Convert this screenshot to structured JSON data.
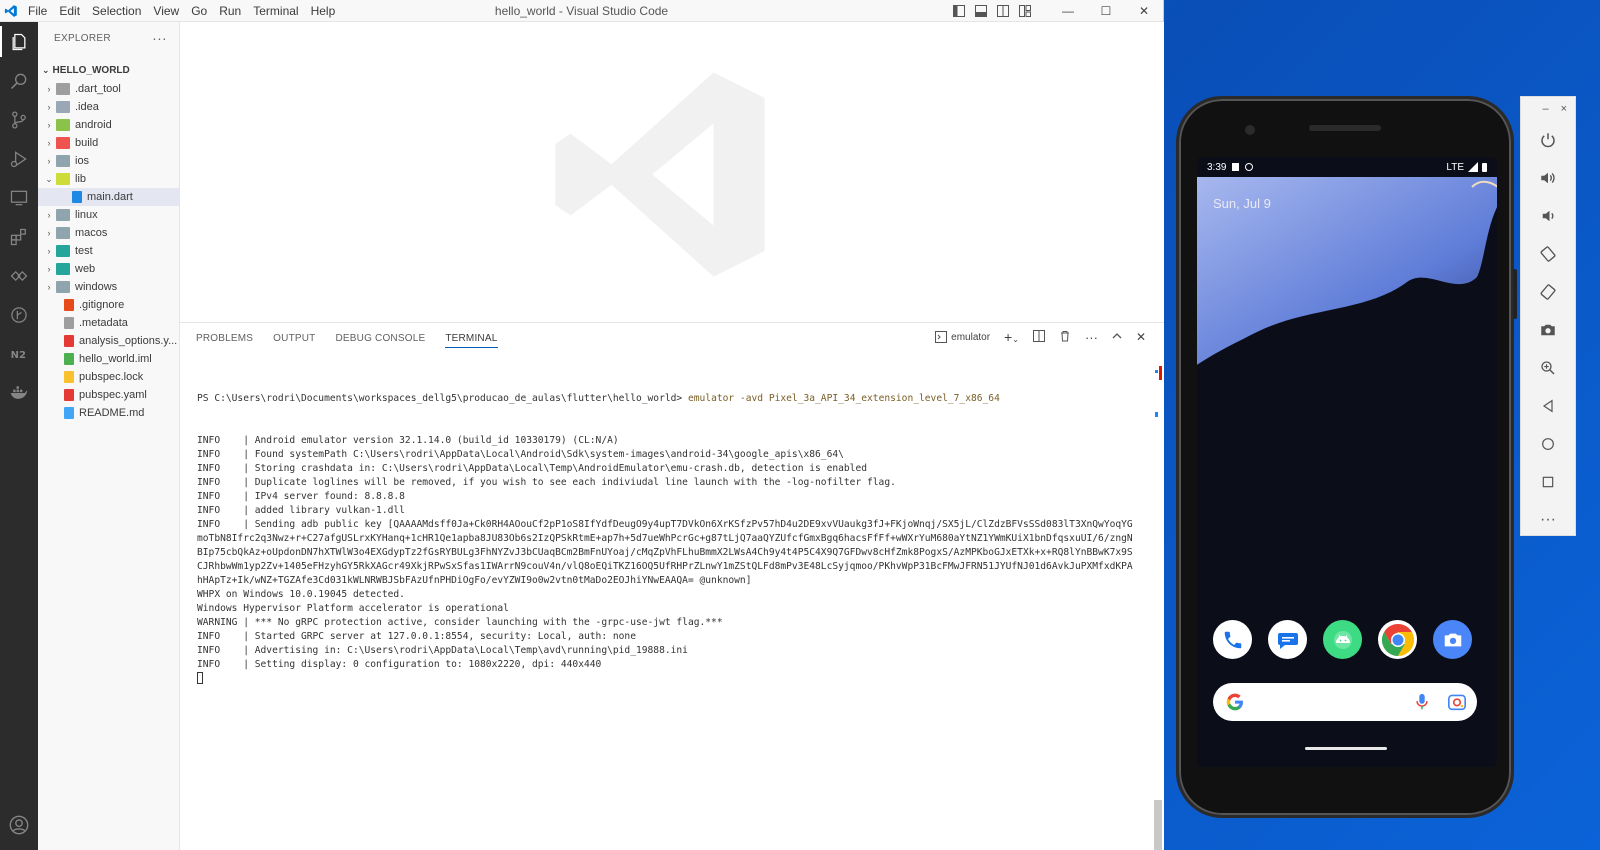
{
  "vscode": {
    "menu": [
      "File",
      "Edit",
      "Selection",
      "View",
      "Go",
      "Run",
      "Terminal",
      "Help"
    ],
    "window_title": "hello_world - Visual Studio Code",
    "explorer": {
      "header": "EXPLORER",
      "more": "···",
      "root": "HELLO_WORLD",
      "items": [
        {
          "label": ".dart_tool",
          "type": "folder",
          "expanded": false
        },
        {
          "label": ".idea",
          "type": "folder",
          "expanded": false
        },
        {
          "label": "android",
          "type": "folder",
          "expanded": false
        },
        {
          "label": "build",
          "type": "folder",
          "expanded": false
        },
        {
          "label": "ios",
          "type": "folder",
          "expanded": false
        },
        {
          "label": "lib",
          "type": "folder",
          "expanded": true
        },
        {
          "label": "main.dart",
          "type": "file",
          "selected": true
        },
        {
          "label": "linux",
          "type": "folder",
          "expanded": false
        },
        {
          "label": "macos",
          "type": "folder",
          "expanded": false
        },
        {
          "label": "test",
          "type": "folder",
          "expanded": false
        },
        {
          "label": "web",
          "type": "folder",
          "expanded": false
        },
        {
          "label": "windows",
          "type": "folder",
          "expanded": false
        },
        {
          "label": ".gitignore",
          "type": "file"
        },
        {
          "label": ".metadata",
          "type": "file"
        },
        {
          "label": "analysis_options.y...",
          "type": "file"
        },
        {
          "label": "hello_world.iml",
          "type": "file"
        },
        {
          "label": "pubspec.lock",
          "type": "file"
        },
        {
          "label": "pubspec.yaml",
          "type": "file"
        },
        {
          "label": "README.md",
          "type": "file"
        }
      ]
    },
    "panel": {
      "tabs": [
        "PROBLEMS",
        "OUTPUT",
        "DEBUG CONSOLE",
        "TERMINAL"
      ],
      "active_tab": "TERMINAL",
      "terminal_name": "emulator",
      "prompt": "PS C:\\Users\\rodri\\Documents\\workspaces_dellg5\\producao_de_aulas\\flutter\\hello_world>",
      "command": " emulator -avd Pixel_3a_API_34_extension_level_7_x86_64",
      "lines": [
        "INFO    | Android emulator version 32.1.14.0 (build_id 10330179) (CL:N/A)",
        "INFO    | Found systemPath C:\\Users\\rodri\\AppData\\Local\\Android\\Sdk\\system-images\\android-34\\google_apis\\x86_64\\",
        "INFO    | Storing crashdata in: C:\\Users\\rodri\\AppData\\Local\\Temp\\AndroidEmulator\\emu-crash.db, detection is enabled",
        "INFO    | Duplicate loglines will be removed, if you wish to see each indiviudal line launch with the -log-nofilter flag.",
        "INFO    | IPv4 server found: 8.8.8.8",
        "INFO    | added library vulkan-1.dll",
        "INFO    | Sending adb public key [QAAAAMdsff0Ja+Ck0RH4AOouCf2pP1oS8IfYdfDeugO9y4upT7DVkOn6XrKSfzPv57hD4u2DE9xvVUaukg3fJ+FKjoWnqj/SX5jL/ClZdzBFVsSSd083lT3XnQwYoqYG",
        "moTbN8Ifrc2q3Nwz+r+C27afgUSLrxKYHanq+1cHR1Qe1apba8JU83Ob6s2IzQPSkRtmE+ap7h+5d7ueWhPcrGc+g87tLjQ7aaQYZUfcfGmxBgq6hacsFfFf+wWXrYuM680aYtNZ1YWmKUiX1bnDfqsxuUI/6/zngN",
        "BIp75cbQkAz+oUpdonDN7hXTWlW3o4EXGdypTz2fGsRYBULg3FhNYZvJ3bCUaqBCm2BmFnUYoaj/cMqZpVhFLhuBmmX2LWsA4Ch9y4t4P5C4X9Q7GFDwv8cHfZmk8PogxS/AzMPKboGJxETXk+x+RQ8lYnBBwK7x9S",
        "CJRhbwWm1yp2Zv+1405eFHzyhGY5RkXAGcr49XkjRPwSxSfas1IWArrN9couV4n/vlQ8oEQiTKZ16OQ5UfRHPrZLnwY1mZStQLFd8mPv3E48LcSyjqmoo/PKhvWpP31BcFMwJFRN51JYUfNJ01d6AvkJuPXMfxdKPA",
        "hHApTz+Ik/wNZ+TGZAfe3Cd031kWLNRWBJSbFAzUfnPHDiOgFo/evYZWI9o0w2vtn0tMaDo2EOJhiYNwEAAQA= @unknown]",
        "WHPX on Windows 10.0.19045 detected.",
        "Windows Hypervisor Platform accelerator is operational",
        "WARNING | *** No gRPC protection active, consider launching with the -grpc-use-jwt flag.***",
        "INFO    | Started GRPC server at 127.0.0.1:8554, security: Local, auth: none",
        "INFO    | Advertising in: C:\\Users\\rodri\\AppData\\Local\\Temp\\avd\\running\\pid_19888.ini",
        "INFO    | Setting display: 0 configuration to: 1080x2220, dpi: 440x440"
      ]
    }
  },
  "emulator": {
    "status_time": "3:39",
    "status_network": "LTE",
    "date": "Sun, Jul 9",
    "dock_apps": [
      "phone-icon",
      "messages-icon",
      "android-icon",
      "chrome-icon",
      "camera-icon"
    ],
    "colors": {
      "phone": "#ffffff",
      "messages": "#ffffff",
      "android": "#3ddc84",
      "chrome": "#ffffff",
      "camera": "#4a86f7"
    },
    "toolbar": {
      "minimize": "–",
      "close": "×",
      "buttons": [
        "power-icon",
        "volume-up-icon",
        "volume-down-icon",
        "rotate-left-icon",
        "rotate-right-icon",
        "screenshot-icon",
        "zoom-icon",
        "back-icon",
        "home-icon",
        "overview-icon",
        "more-icon"
      ]
    }
  }
}
